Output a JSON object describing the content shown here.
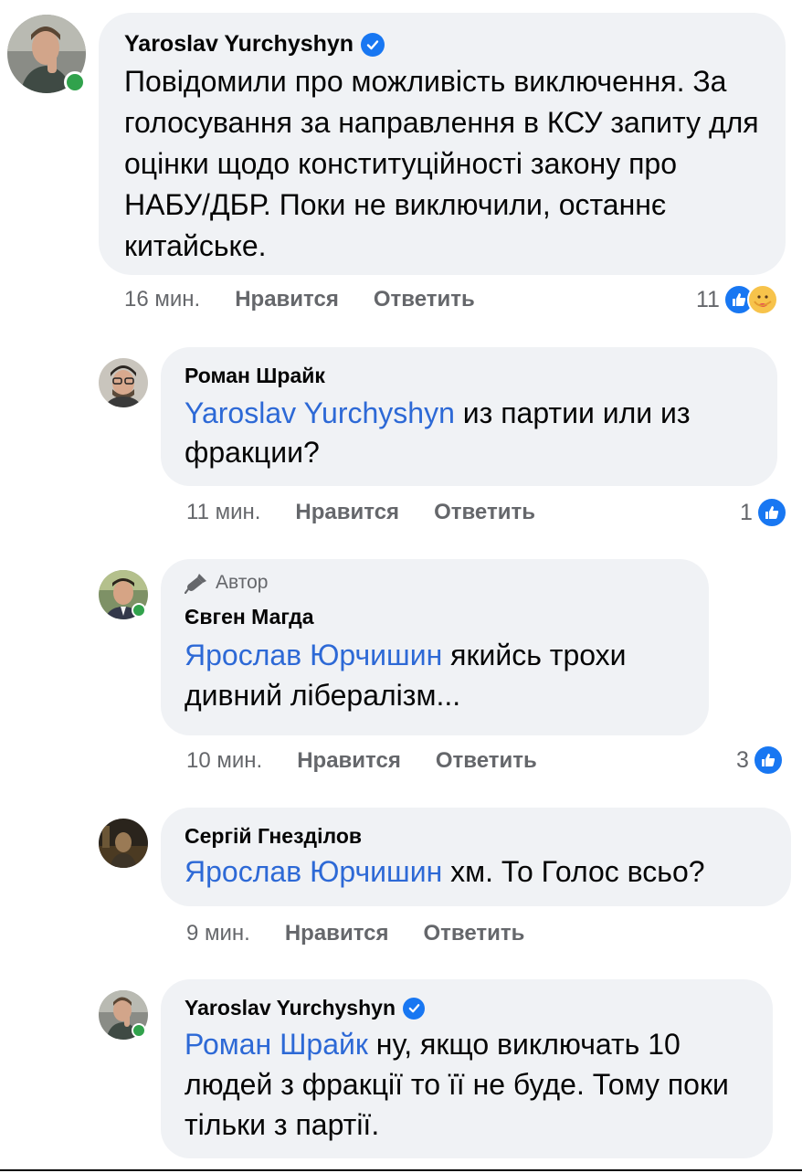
{
  "colors": {
    "bubble": "#f0f2f5",
    "mention": "#2d69d6",
    "meta": "#65676b",
    "like": "#1877f2",
    "online": "#31a24c"
  },
  "comments": [
    {
      "author": "Yaroslav Yurchyshyn",
      "verified": true,
      "text": "Повідомили про можливість виключення. За голосування за направлення в КСУ запиту для оцінки щодо конституційності закону про НАБУ/ДБР. Поки не виключили, останнє китайське.",
      "time": "16 мин.",
      "like_label": "Нравится",
      "reply_label": "Ответить",
      "reaction_count": "11",
      "reactions": [
        "like-icon",
        "care-icon"
      ]
    },
    {
      "author": "Роман Шрайк",
      "mention": "Yaroslav Yurchyshyn",
      "text": " из партии или из фракции?",
      "time": "11 мин.",
      "like_label": "Нравится",
      "reply_label": "Ответить",
      "reaction_count": "1",
      "reactions": [
        "like-icon"
      ]
    },
    {
      "badge": "Автор",
      "badge_icon": "microphone-icon",
      "author": "Євген Магда",
      "mention": "Ярослав Юрчишин",
      "text": " якийсь трохи дивний лібералізм...",
      "time": "10 мин.",
      "like_label": "Нравится",
      "reply_label": "Ответить",
      "reaction_count": "3",
      "reactions": [
        "like-icon"
      ]
    },
    {
      "author": "Сергій Гнезділов",
      "mention": "Ярослав Юрчишин",
      "text": " хм. То Голос всьо?",
      "time": "9 мин.",
      "like_label": "Нравится",
      "reply_label": "Ответить"
    },
    {
      "author": "Yaroslav Yurchyshyn",
      "verified": true,
      "mention": "Роман Шрайк",
      "text": " ну, якщо виключать 10 людей з фракції то її не буде. Тому поки тільки з партії."
    }
  ]
}
